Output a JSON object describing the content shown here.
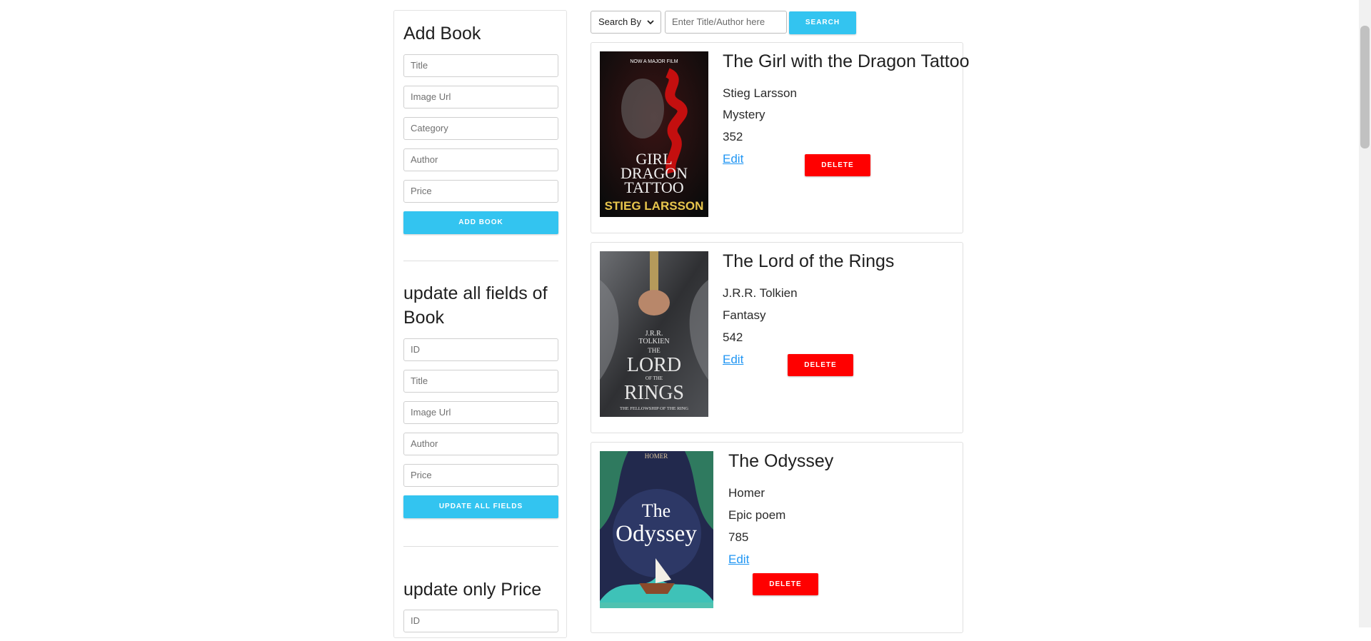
{
  "sidebar": {
    "add_book": {
      "title": "Add Book",
      "fields": [
        "Title",
        "Image Url",
        "Category",
        "Author",
        "Price"
      ],
      "button": "ADD BOOK"
    },
    "update_all": {
      "title": "update all fields of Book",
      "fields": [
        "ID",
        "Title",
        "Image Url",
        "Author",
        "Price"
      ],
      "button": "UPDATE ALL FIELDS"
    },
    "update_price": {
      "title": "update only Price",
      "fields": [
        "ID"
      ]
    }
  },
  "search": {
    "select_label": "Search By",
    "placeholder": "Enter Title/Author here",
    "button": "SEARCH"
  },
  "books": [
    {
      "title": "The Girl with the Dragon Tattoo",
      "author": "Stieg Larsson",
      "category": "Mystery",
      "price": "352",
      "edit": "Edit",
      "delete": "DELETE",
      "cover_text": [
        "NOW A MAJOR FILM",
        "GIRL",
        "DRAGON",
        "TATTOO",
        "STIEG LARSSON"
      ]
    },
    {
      "title": "The Lord of the Rings",
      "author": "J.R.R. Tolkien",
      "category": "Fantasy",
      "price": "542",
      "edit": "Edit",
      "delete": "DELETE",
      "cover_text": [
        "J.R.R.",
        "TOLKIEN",
        "THE",
        "LORD",
        "OF THE",
        "RINGS",
        "THE FELLOWSHIP OF THE RING"
      ]
    },
    {
      "title": "The Odyssey",
      "author": "Homer",
      "category": "Epic poem",
      "price": "785",
      "edit": "Edit",
      "delete": "DELETE",
      "cover_text": [
        "HOMER",
        "The",
        "Odyssey"
      ]
    }
  ],
  "colors": {
    "primary_button": "#33c4f0",
    "delete_button": "#ff0000",
    "link": "#2196f3"
  }
}
